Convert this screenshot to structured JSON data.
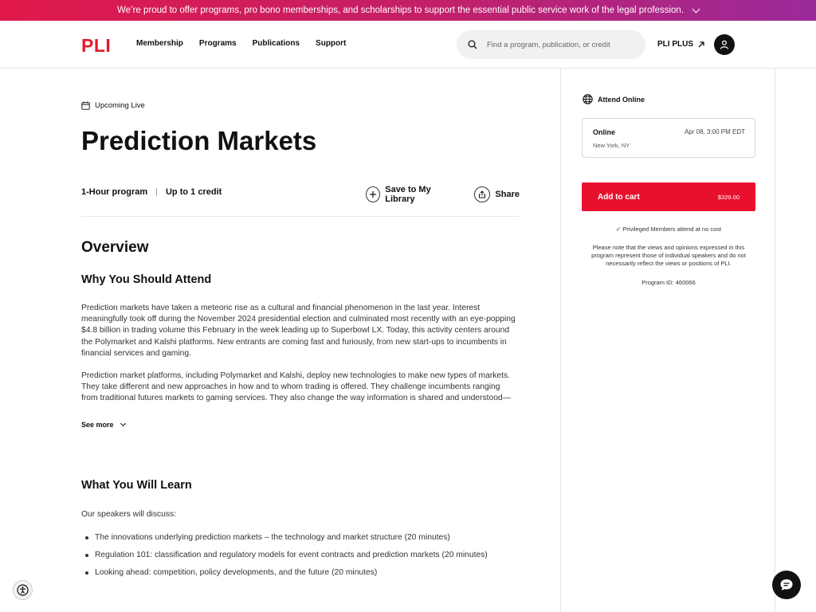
{
  "banner": {
    "text": "We’re proud to offer programs, pro bono memberships, and scholarships to support the essential public service work of the legal profession."
  },
  "nav": {
    "logo": "PLI",
    "links": [
      "Membership",
      "Programs",
      "Publications",
      "Support"
    ],
    "search_placeholder": "Find a program, publication, or credit",
    "plus_label": "PLI PLUS"
  },
  "main": {
    "status": "Upcoming Live",
    "title": "Prediction Markets",
    "duration": "1-Hour program",
    "credit": "Up to 1 credit",
    "save_label": "Save to My Library",
    "share_label": "Share",
    "overview_heading": "Overview",
    "why_heading": "Why You Should Attend",
    "why_p1": "Prediction markets have taken a meteoric rise as a cultural and financial phenomenon in the last year. Interest meaningfully took off during the November 2024 presidential election and culminated most recently with an eye-popping $4.8 billion in trading volume this February in the week leading up to Superbowl LX. Today, this activity centers around the Polymarket and Kalshi platforms. New entrants are coming fast and furiously, from new start-ups to incumbents in financial services and gaming.",
    "why_p2": "Prediction market platforms, including Polymarket and Kalshi, deploy new technologies to make new types of markets. They take different and new approaches in how and to whom trading is offered. They challenge incumbents ranging from traditional futures markets to gaming services. They also change the way information is shared and understood—",
    "see_more": "See more",
    "learn_heading": "What You Will Learn",
    "learn_intro": "Our speakers will discuss:",
    "learn_items": [
      "The innovations underlying prediction markets – the technology and market structure (20 minutes)",
      "Regulation 101: classification and regulatory models for event contracts and prediction markets (20 minutes)",
      "Looking ahead: competition, policy developments, and the future (20 minutes)"
    ]
  },
  "sidebar": {
    "attend_label": "Attend Online",
    "session": {
      "type": "Online",
      "date": "Apr 08, 3:00 PM EDT",
      "location": "New York, NY"
    },
    "cart_label": "Add to cart",
    "price": "$329.00",
    "privileged": "Privileged Members attend at no cost",
    "disclaimer": "Please note that the views and opinions expressed in this program represent those of individual speakers and do not necessarily reflect the views or positions of PLI.",
    "program_id": "Program ID: 460066"
  },
  "colors": {
    "brand_red": "#e11a2b",
    "cart_red": "#e8112d",
    "banner_start": "#e0194a",
    "banner_end": "#9a2a9a"
  },
  "icons": [
    "chevron-down-icon",
    "search-icon",
    "external-arrow-icon",
    "user-icon",
    "calendar-icon",
    "plus-icon",
    "share-icon",
    "globe-icon",
    "check-icon",
    "accessibility-icon",
    "chat-icon"
  ]
}
